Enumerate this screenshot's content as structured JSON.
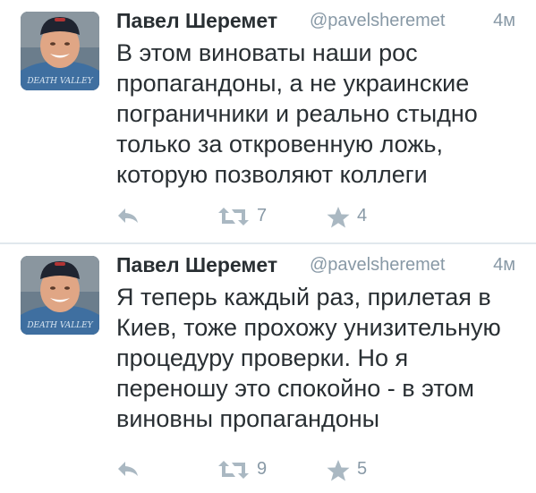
{
  "tweets": [
    {
      "display_name": "Павел Шеремет",
      "handle": "@pavelsheremet",
      "time": "4м",
      "avatar_shirt_text": "DEATH VALLEY",
      "text_lines": [
        "В этом виноваты наши рос",
        "пропагандоны, а не украинские",
        "пограничники и реально стыдно",
        "только за откровенную ложь,",
        "которую позволяют коллеги"
      ],
      "actions": {
        "reply_icon": "reply-icon",
        "retweet_icon": "retweet-icon",
        "retweet_count": "7",
        "favorite_icon": "star-icon",
        "favorite_count": "4"
      }
    },
    {
      "display_name": "Павел Шеремет",
      "handle": "@pavelsheremet",
      "time": "4м",
      "avatar_shirt_text": "DEATH VALLEY",
      "text_lines": [
        "Я теперь каждый раз, прилетая в",
        "Киев, тоже прохожу унизительную",
        "процедуру проверки. Но я",
        "переношу это спокойно - в этом",
        "виновны пропагандоны"
      ],
      "actions": {
        "reply_icon": "reply-icon",
        "retweet_icon": "retweet-icon",
        "retweet_count": "9",
        "favorite_icon": "star-icon",
        "favorite_count": "5"
      }
    }
  ],
  "colors": {
    "text": "#292f33",
    "secondary": "#8899a6",
    "icon": "#aab8c2",
    "divider": "#e1e8ed"
  }
}
